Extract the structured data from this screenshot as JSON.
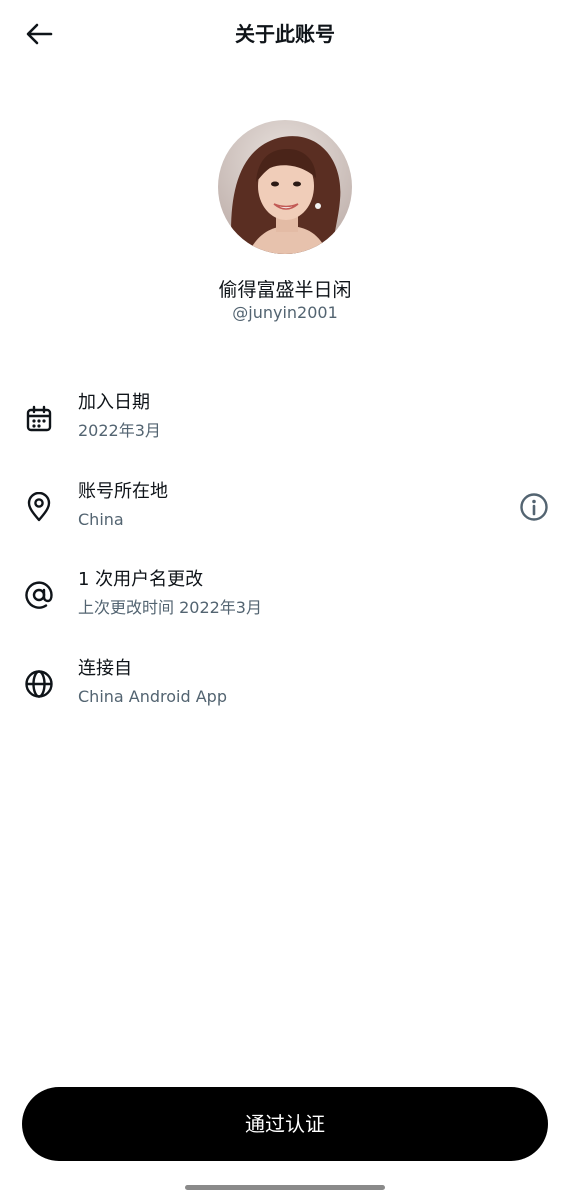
{
  "header": {
    "title": "关于此账号",
    "back_icon": "arrow-left-icon"
  },
  "profile": {
    "display_name": "偷得富盛半日闲",
    "handle": "@junyin2001"
  },
  "rows": [
    {
      "icon": "calendar-icon",
      "title": "加入日期",
      "subtitle": "2022年3月"
    },
    {
      "icon": "location-pin-icon",
      "title": "账号所在地",
      "subtitle": "China"
    },
    {
      "icon": "at-sign-icon",
      "title": "1 次用户名更改",
      "subtitle": "上次更改时间 2022年3月"
    },
    {
      "icon": "globe-icon",
      "title": "连接自",
      "subtitle": "China Android App"
    }
  ],
  "verify_button": {
    "label": "通过认证"
  },
  "colors": {
    "primary_text": "#0f1419",
    "secondary_text": "#536471",
    "button_bg": "#000000"
  }
}
